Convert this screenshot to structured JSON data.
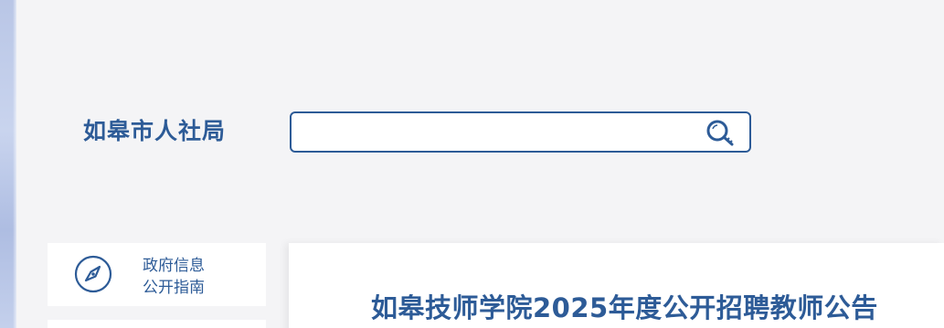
{
  "header": {
    "site_title": "如皋市人社局"
  },
  "search": {
    "placeholder": "",
    "value": "",
    "icon": "search-icon"
  },
  "sidebar": {
    "items": [
      {
        "icon": "compass-icon",
        "label_line1": "政府信息",
        "label_line2": "公开指南"
      }
    ]
  },
  "main": {
    "article_title": "如皋技师学院2025年度公开招聘教师公告"
  },
  "colors": {
    "brand": "#2d5b97",
    "background": "#f4f4f6",
    "card": "#ffffff"
  }
}
